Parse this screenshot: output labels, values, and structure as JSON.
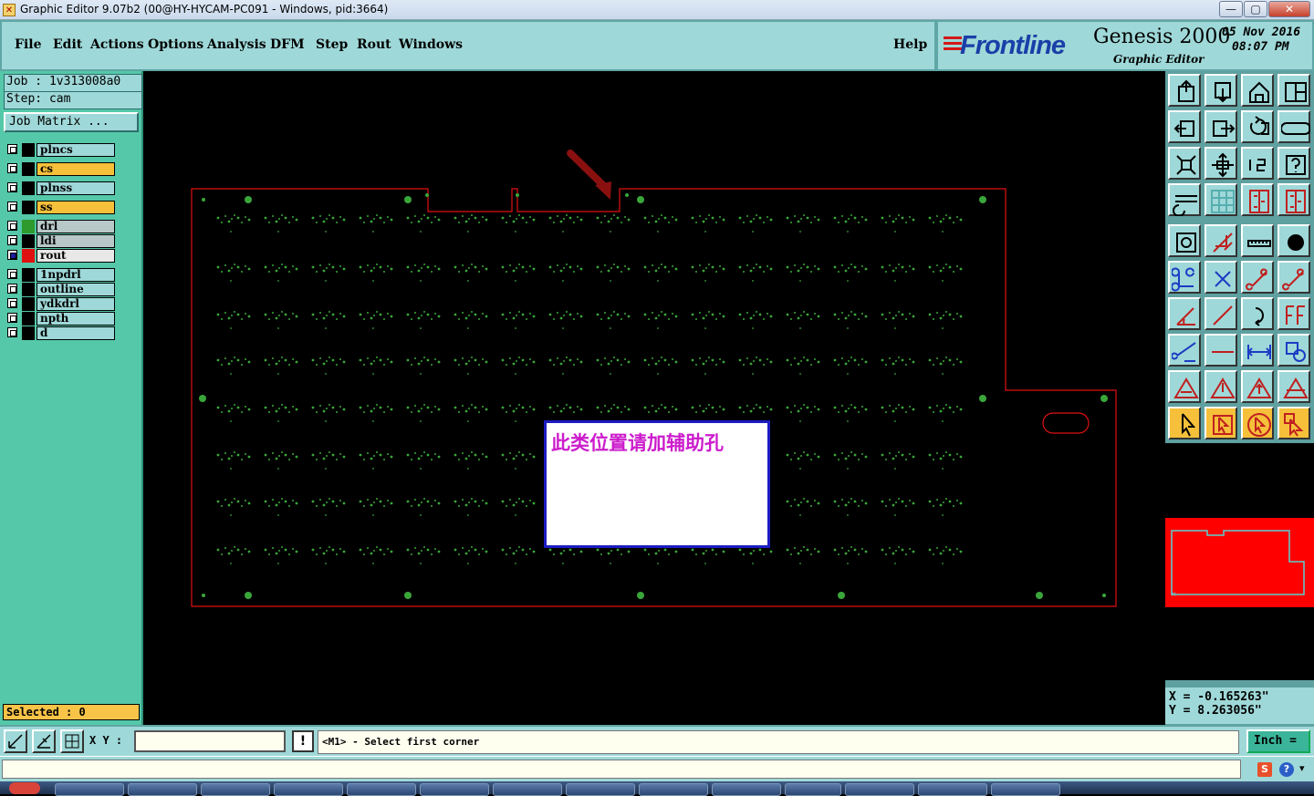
{
  "window": {
    "title": "Graphic Editor 9.07b2 (00@HY-HYCAM-PC091 - Windows, pid:3664)",
    "minimize": "—",
    "maximize": "▢",
    "close": "✕"
  },
  "menu": {
    "items": [
      "File",
      "Edit",
      "Actions",
      "Options",
      "Analysis",
      "DFM",
      "Step",
      "Rout",
      "Windows"
    ],
    "help": "Help"
  },
  "brand": {
    "logo": "Frontline",
    "product": "Genesis 2000",
    "subtitle": "Graphic Editor",
    "date": "05 Nov 2016",
    "time": "08:07 PM"
  },
  "job": {
    "job_line": "Job : 1v313008a0",
    "step_line": "Step: cam",
    "matrix_button": "Job Matrix ..."
  },
  "layers": [
    {
      "name": "plncs",
      "color": "#9fd8d8",
      "swatch": "#000000",
      "group": 1
    },
    {
      "name": "cs",
      "color": "#f6c03a",
      "swatch": "#000000",
      "group": 1
    },
    {
      "name": "plnss",
      "color": "#9fd8d8",
      "swatch": "#000000",
      "group": 1
    },
    {
      "name": "ss",
      "color": "#f6c03a",
      "swatch": "#000000",
      "group": 1
    },
    {
      "name": "drl",
      "color": "#b8c8c8",
      "swatch": "#2e9a2e",
      "group": 2
    },
    {
      "name": "ldi",
      "color": "#b8c8c8",
      "swatch": "#000000",
      "group": 2
    },
    {
      "name": "rout",
      "color": "#e8e8e8",
      "swatch": "#e01010",
      "group": 2,
      "active": true
    },
    {
      "name": "1npdrl",
      "color": "#9fd8d8",
      "swatch": "#000000",
      "group": 3
    },
    {
      "name": "outline",
      "color": "#9fd8d8",
      "swatch": "#000000",
      "group": 3
    },
    {
      "name": "ydkdrl",
      "color": "#9fd8d8",
      "swatch": "#000000",
      "group": 3
    },
    {
      "name": "npth",
      "color": "#9fd8d8",
      "swatch": "#000000",
      "group": 3
    },
    {
      "name": "d",
      "color": "#9fd8d8",
      "swatch": "#000000",
      "group": 3
    }
  ],
  "selected": "Selected : 0",
  "annotation": "此类位置请加辅助孔",
  "coords": {
    "x": "X = -0.165263\"",
    "y": "Y = 8.263056\""
  },
  "command": {
    "xy_label": "X Y :",
    "xy_value": "",
    "excl": "!",
    "prompt": "<M1> - Select first corner",
    "units": "Inch ="
  },
  "colors": {
    "outline": "#e01010",
    "holes": "#3aa63a",
    "annotation_border": "#1c1cc4",
    "annotation_text": "#cc1ccc"
  },
  "toolbar_icons": [
    "open-step-icon",
    "save-icon",
    "home-icon",
    "window-layout-icon",
    "import-icon",
    "export-icon",
    "rotate-icon",
    "mirror-icon",
    "zoom-extents-icon",
    "pan-icon",
    "scale-1-2-icon",
    "help-icon",
    "measure-settings-icon",
    "grid-icon",
    "layer-snap-icon",
    "layer-snap-active-icon",
    "zoom-window-icon",
    "draw-shape-icon",
    "ruler-icon",
    "pad-icon",
    "connect-nodes-icon",
    "cross-icon",
    "line-node-icon",
    "line-node-blue-icon",
    "angle-icon",
    "slash-line-icon",
    "arc-icon",
    "text-f-icon",
    "move-node-icon",
    "minus-line-icon",
    "dimension-icon",
    "shapes-icon",
    "triangle-icon",
    "triangle-up-icon",
    "triangle-arrow-icon",
    "triangle-measure-icon",
    "select-arrow-icon",
    "select-box-icon",
    "select-circle-icon",
    "select-multi-icon"
  ]
}
